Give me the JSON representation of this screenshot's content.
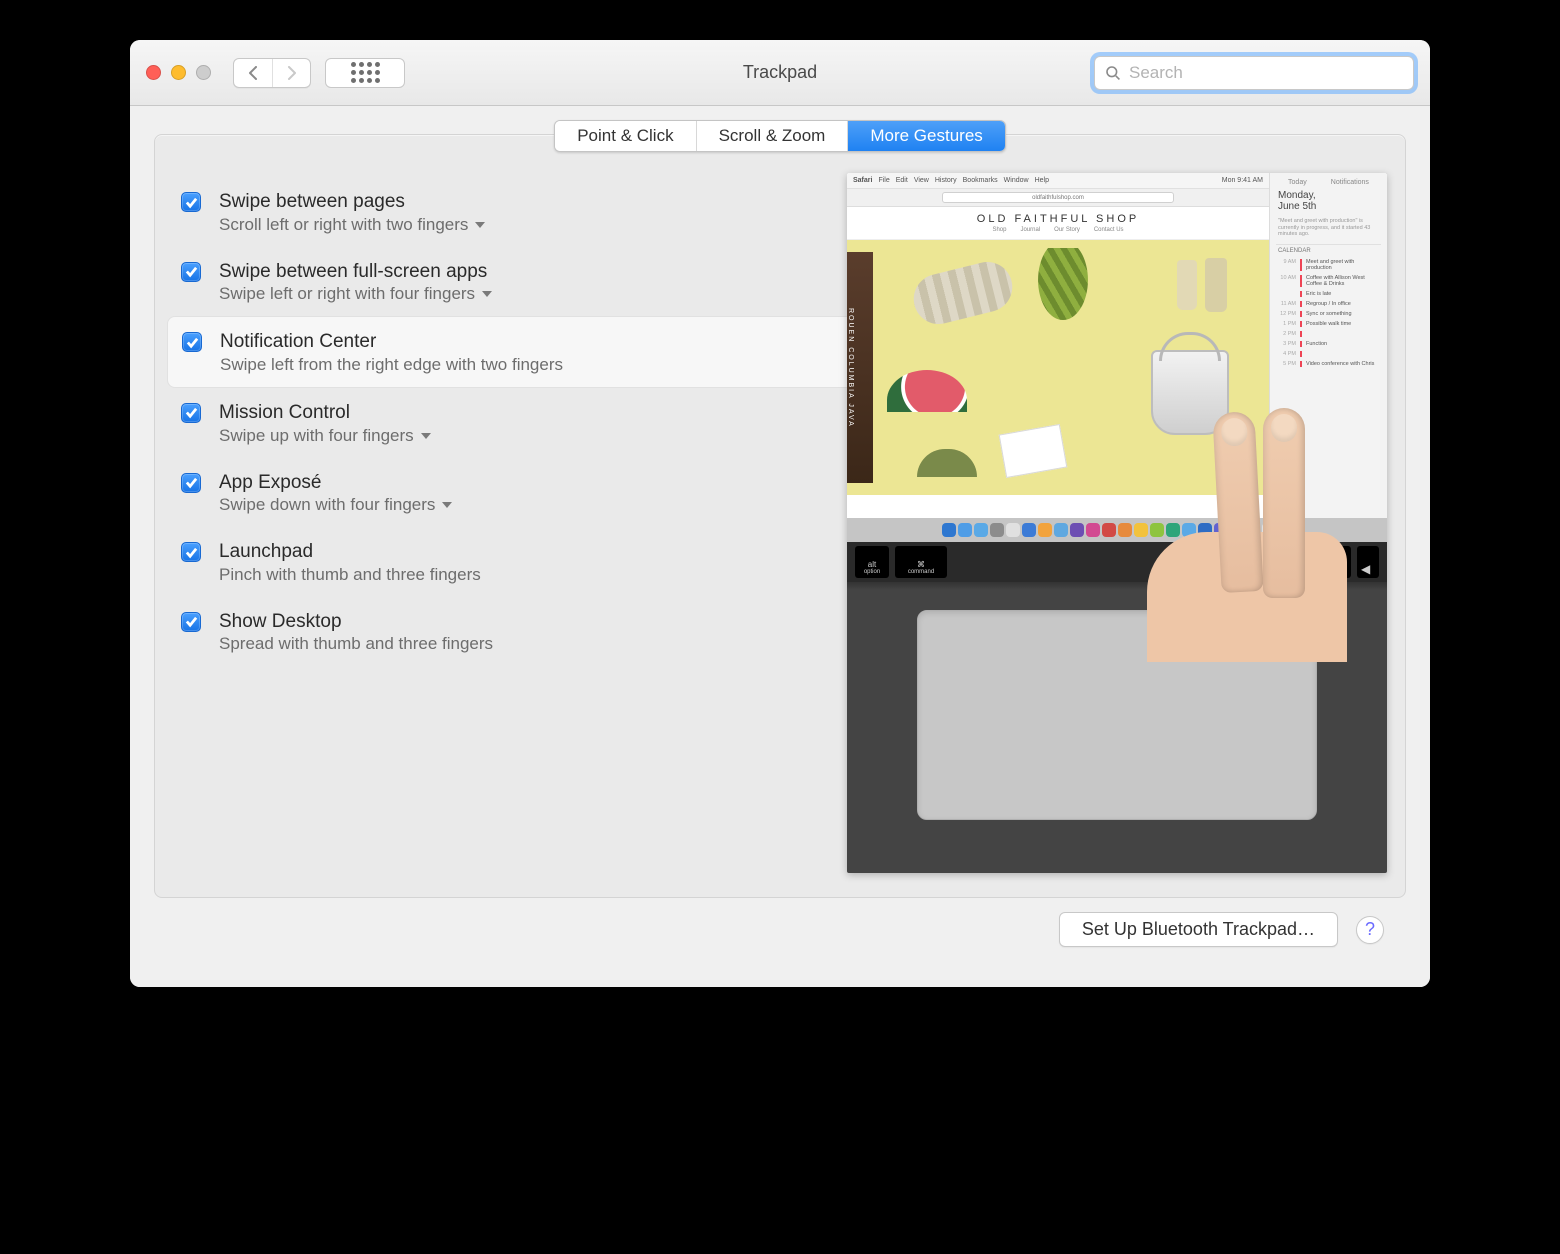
{
  "window": {
    "title": "Trackpad"
  },
  "search": {
    "placeholder": "Search",
    "value": ""
  },
  "tabs": [
    {
      "label": "Point & Click",
      "active": false
    },
    {
      "label": "Scroll & Zoom",
      "active": false
    },
    {
      "label": "More Gestures",
      "active": true
    }
  ],
  "gestures": [
    {
      "checked": true,
      "selected": false,
      "disclosure": true,
      "title": "Swipe between pages",
      "subtitle": "Scroll left or right with two fingers"
    },
    {
      "checked": true,
      "selected": false,
      "disclosure": true,
      "title": "Swipe between full-screen apps",
      "subtitle": "Swipe left or right with four fingers"
    },
    {
      "checked": true,
      "selected": true,
      "disclosure": false,
      "title": "Notification Center",
      "subtitle": "Swipe left from the right edge with two fingers"
    },
    {
      "checked": true,
      "selected": false,
      "disclosure": true,
      "title": "Mission Control",
      "subtitle": "Swipe up with four fingers"
    },
    {
      "checked": true,
      "selected": false,
      "disclosure": true,
      "title": "App Exposé",
      "subtitle": "Swipe down with four fingers"
    },
    {
      "checked": true,
      "selected": false,
      "disclosure": false,
      "title": "Launchpad",
      "subtitle": "Pinch with thumb and three fingers"
    },
    {
      "checked": true,
      "selected": false,
      "disclosure": false,
      "title": "Show Desktop",
      "subtitle": "Spread with thumb and three fingers"
    }
  ],
  "preview": {
    "menubar_app": "Safari",
    "menubar_items": [
      "File",
      "Edit",
      "View",
      "History",
      "Bookmarks",
      "Window",
      "Help"
    ],
    "menubar_clock": "Mon 9:41 AM",
    "url": "oldfaithfulshop.com",
    "page_title": "OLD FAITHFUL SHOP",
    "page_nav": [
      "Shop",
      "Journal",
      "Our Story",
      "Contact Us"
    ],
    "strip_text": "ROUEN COLUMBIA JAVA",
    "nc": {
      "tabs": [
        "Today",
        "Notifications"
      ],
      "date_line1": "Monday,",
      "date_line2": "June 5th",
      "blurb": "\"Meet and greet with production\" is currently in progress, and it started 43 minutes ago.",
      "section": "CALENDAR",
      "events": [
        {
          "time": "9 AM",
          "label": "Meet and greet with production"
        },
        {
          "time": "10 AM",
          "label": "Coffee with Allison West Coffee & Drinks"
        },
        {
          "time": "",
          "label": "Eric is late"
        },
        {
          "time": "11 AM",
          "label": "Regroup / In office"
        },
        {
          "time": "12 PM",
          "label": "Sync or something"
        },
        {
          "time": "1 PM",
          "label": "Possible walk time"
        },
        {
          "time": "2 PM",
          "label": ""
        },
        {
          "time": "3 PM",
          "label": "Function"
        },
        {
          "time": "4 PM",
          "label": ""
        },
        {
          "time": "5 PM",
          "label": "Video conference with Chris"
        }
      ]
    },
    "keys": {
      "alt": "alt",
      "option": "option",
      "command": "command",
      "cmd_symbol": "⌘"
    },
    "dock_colors": [
      "#2e77d0",
      "#4f9de6",
      "#5aa9e6",
      "#8c8c8c",
      "#e0e0e0",
      "#3c7bd6",
      "#f2a33c",
      "#5fa8e0",
      "#6d4fb3",
      "#d24a91",
      "#d24a45",
      "#e68a3c",
      "#f2c23c",
      "#8ec43f",
      "#2ea57a",
      "#5aa9e6",
      "#2e6cc4",
      "#6262d0",
      "#3c3c3c",
      "#4aa7e6",
      "#e0e0e0",
      "#4f9de6"
    ]
  },
  "footer": {
    "bluetooth_button": "Set Up Bluetooth Trackpad…",
    "help_label": "?"
  }
}
